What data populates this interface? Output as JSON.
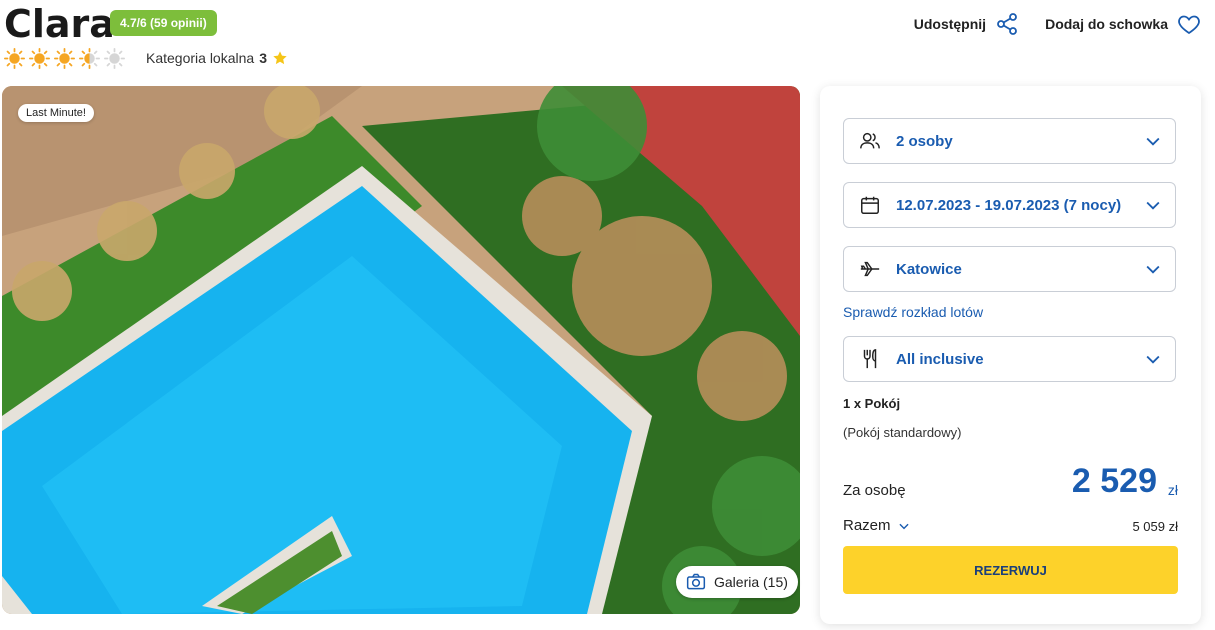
{
  "hotel": {
    "name": "Clara",
    "rating_badge": "4.7/6 (59 opinii)",
    "stars_filled": 3.5,
    "stars_total": 5,
    "category_prefix": "Kategoria lokalna",
    "category_value": "3"
  },
  "actions": {
    "share_label": "Udostępnij",
    "save_label": "Dodaj do schowka"
  },
  "photo": {
    "badge": "Last Minute!",
    "gallery_label": "Galeria (15)"
  },
  "booking": {
    "persons": "2 osoby",
    "dates": "12.07.2023 - 19.07.2023 (7 nocy)",
    "departure": "Katowice",
    "flights_link": "Sprawdź rozkład lotów",
    "board": "All inclusive",
    "room_count": "1 x Pokój",
    "room_type": "(Pokój standardowy)",
    "per_person_label": "Za osobę",
    "per_person_price": "2 529",
    "currency": "zł",
    "total_label": "Razem",
    "total_value": "5 059 zł",
    "book_button": "REZERWUJ"
  },
  "colors": {
    "accent_blue": "#1a5cb0",
    "rating_green": "#7dbe3b",
    "cta_yellow": "#fdd22a",
    "sun_orange": "#f5a623"
  },
  "icons": [
    "sun-icon",
    "star-icon",
    "share-icon",
    "heart-icon",
    "camera-icon",
    "users-icon",
    "calendar-icon",
    "plane-icon",
    "cutlery-icon",
    "chevron-down-icon"
  ]
}
